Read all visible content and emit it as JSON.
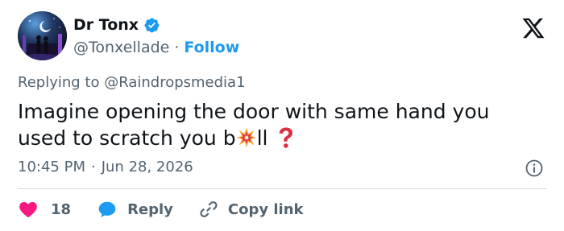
{
  "author": {
    "display_name": "Dr Tonx",
    "handle": "@Tonxellade",
    "separator": "·",
    "follow_label": "Follow",
    "verified_icon": "verified-badge-icon",
    "verified_color": "#1d9bf0"
  },
  "reply_context": {
    "prefix": "Replying to",
    "mention": "@Raindropsmedia1"
  },
  "tweet": {
    "text_line1": "Imagine opening the door with same hand you",
    "text_before_emoji": "used to scratch you b",
    "emoji_1": "collision-emoji",
    "text_after_emoji": "ll",
    "emoji_2": "red-question-mark-emoji"
  },
  "meta": {
    "time": "10:45 PM",
    "separator": "·",
    "date": "Jun 28, 2026"
  },
  "actions": {
    "like_count": "18",
    "reply_label": "Reply",
    "copy_label": "Copy link"
  },
  "colors": {
    "like": "#f91880",
    "reply": "#1d9bf0",
    "link": "#1d9bf0",
    "text_secondary": "#536471",
    "divider": "#cfd9de"
  }
}
